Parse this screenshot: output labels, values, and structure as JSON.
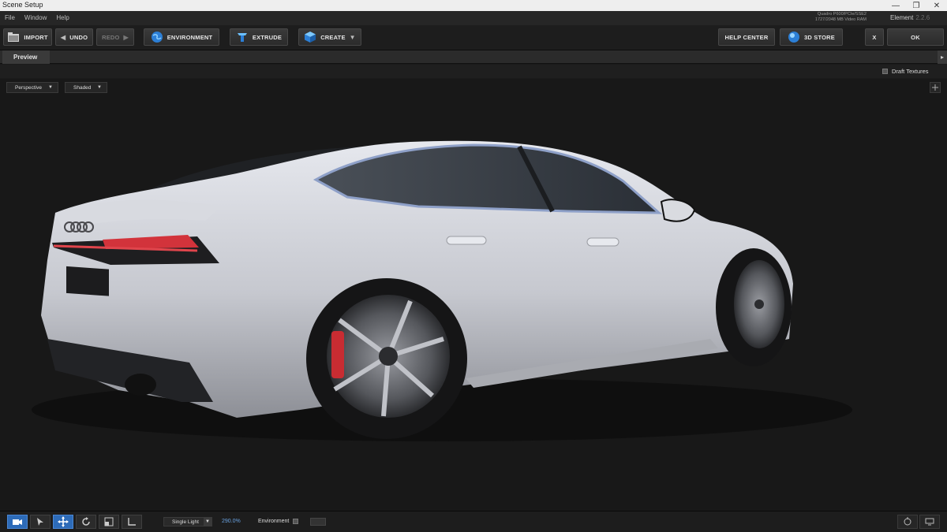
{
  "window": {
    "title": "Scene Setup",
    "controls": [
      "minimize-icon",
      "restore-icon",
      "close-icon"
    ]
  },
  "menu": {
    "items": [
      "File",
      "Window",
      "Help"
    ],
    "gpu_info_line1": "Quadro P600/PCIe/SSE2",
    "gpu_info_line2": "1727/2048 MB Video RAM",
    "element_label": "Element",
    "element_version": "2.2.6"
  },
  "toolbar": {
    "import": "IMPORT",
    "undo": "UNDO",
    "redo": "REDO",
    "environment": "ENVIRONMENT",
    "extrude": "EXTRUDE",
    "create": "CREATE",
    "help_center": "HELP CENTER",
    "store": "3D STORE",
    "close": "X",
    "ok": "OK"
  },
  "tabs": {
    "preview": "Preview"
  },
  "options": {
    "draft_textures": "Draft Textures",
    "draft_checked": false
  },
  "viewport": {
    "camera": "Perspective",
    "shading": "Shaded"
  },
  "bottom": {
    "light_mode": "Single Light",
    "light_percent": "290.0%",
    "environment_label": "Environment"
  },
  "colors": {
    "accent_blue": "#2d6bb8",
    "percent_text": "#6aa2e0",
    "car_body": "#c9cbd2",
    "taillight": "#d2333b"
  }
}
